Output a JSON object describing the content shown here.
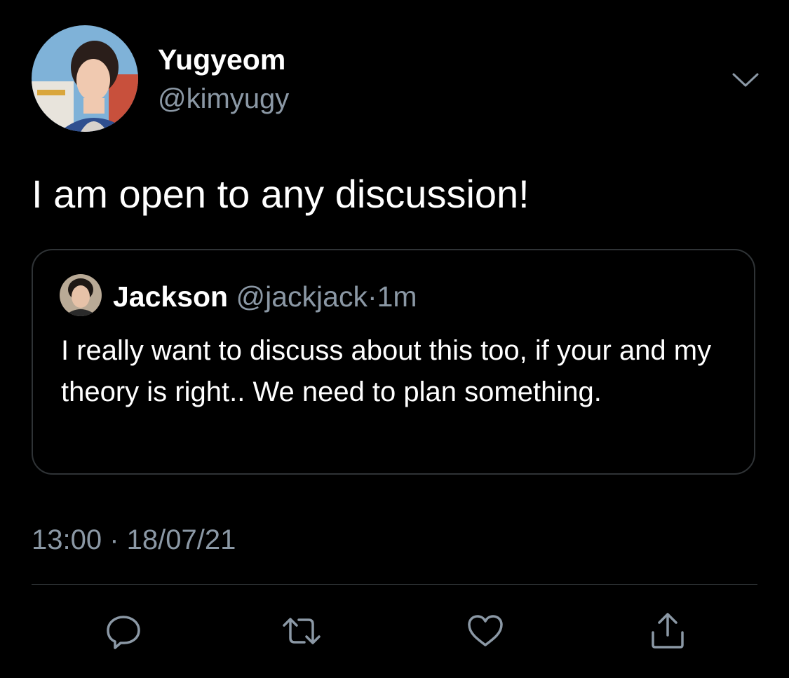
{
  "tweet": {
    "author_name": "Yugyeom",
    "author_handle": "@kimyugy",
    "text": "I am open to any discussion!",
    "timestamp": "13:00 · 18/07/21",
    "menu_icon": "chevron-down-icon"
  },
  "quoted_tweet": {
    "author_name": "Jackson",
    "author_handle": "@jackjack",
    "separator": "·",
    "time": "1m",
    "text": "I really want to discuss about this too, if your and my theory is right.. We need to plan something."
  },
  "actions": [
    {
      "icon": "reply-icon"
    },
    {
      "icon": "retweet-icon"
    },
    {
      "icon": "like-icon"
    },
    {
      "icon": "share-icon"
    }
  ],
  "colors": {
    "background": "#000000",
    "text_primary": "#ffffff",
    "text_secondary": "#8b98a5",
    "border": "#2f3336"
  }
}
